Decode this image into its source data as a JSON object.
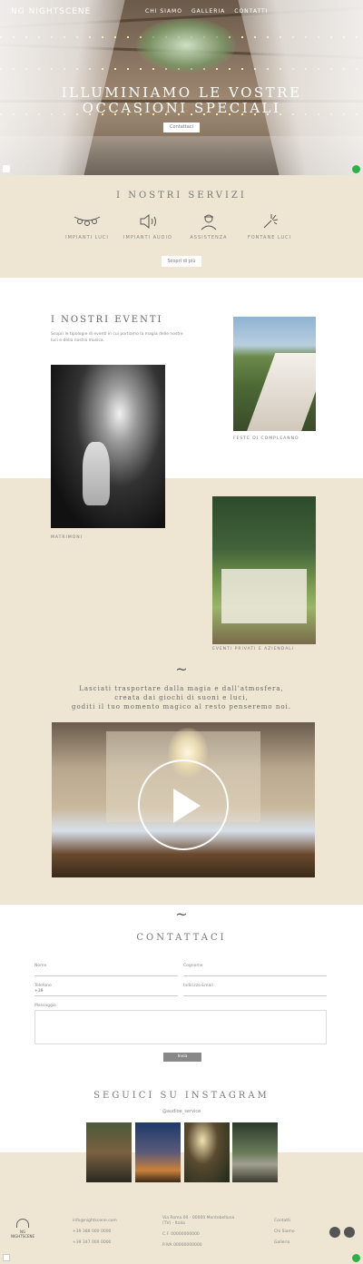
{
  "brand": {
    "logo": "NG NIGHTSCENE"
  },
  "nav": {
    "items": [
      "CHI SIAMO",
      "GALLERIA",
      "CONTATTI"
    ]
  },
  "hero": {
    "title_line1": "ILLUMINIAMO LE VOSTRE",
    "title_line2": "OCCASIONI SPECIALI",
    "button": "Contattaci"
  },
  "services": {
    "title": "I NOSTRI SERVIZI",
    "items": [
      {
        "label": "IMPIANTI LUCI",
        "icon": "string-lights-icon"
      },
      {
        "label": "IMPIANTI AUDIO",
        "icon": "speaker-icon"
      },
      {
        "label": "ASSISTENZA",
        "icon": "technician-icon"
      },
      {
        "label": "FONTANE LUCI",
        "icon": "sparkler-icon"
      }
    ],
    "button": "Scopri di più"
  },
  "events": {
    "title": "I NOSTRI EVENTI",
    "description": "Scopri le tipologie di eventi in cui portiamo la magia delle nostre luci e della nostra musica.",
    "cards": [
      {
        "caption": "FESTE DI COMPLEANNO"
      },
      {
        "caption": "MATRIMONI"
      },
      {
        "caption": "EVENTI PRIVATI E AZIENDALI"
      }
    ]
  },
  "quote": {
    "line1": "Lasciati trasportare dalla magia e dall'atmosfera,",
    "line2": "creata dai giochi di suoni e luci,",
    "line3": "goditi il tuo momento magico al resto penseremo noi."
  },
  "contact": {
    "title": "CONTATTACI",
    "fields": {
      "name": "Nome",
      "surname": "Cognome",
      "phone": "Telefono",
      "email": "Indirizzo Email",
      "message": "Messaggio"
    },
    "phone_prefix": "+39",
    "submit": "Invia"
  },
  "instagram": {
    "title": "SEGUICI SU INSTAGRAM",
    "handle": "@audioe_service"
  },
  "footer": {
    "col1": [
      "info@nightscene.com",
      "+39 388 000 0000",
      "+39 347 000 0000"
    ],
    "col2": [
      "Via Roma 00 - 00000 Montebelluna",
      "(TV) - Italia",
      "C.F. 00000000000",
      "P.IVA 00000000000"
    ],
    "col3": [
      "Contatti",
      "Chi Siamo",
      "Galleria"
    ]
  },
  "colors": {
    "beige": "#eee6d3",
    "whatsapp": "#31b04a",
    "text": "#555555"
  }
}
